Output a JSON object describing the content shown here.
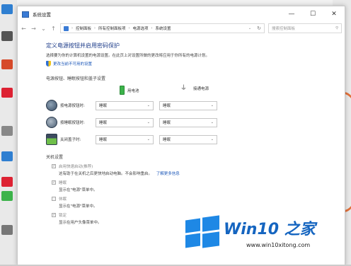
{
  "window": {
    "title": "系统设置",
    "minimize": "—",
    "maximize": "☐",
    "close": "✕"
  },
  "nav": {
    "back": "←",
    "forward": "→",
    "dropdown": "⌄",
    "up": "↑",
    "breadcrumb": [
      "控制面板",
      "所有控制面板项",
      "电源选项",
      "系统设置"
    ],
    "refresh": "↻",
    "search_placeholder": "搜索控制面板"
  },
  "main": {
    "heading": "定义电源按钮并启用密码保护",
    "description": "选择要为你的计算机设置的电源设置。在此页上对设置所做的更改将应用于你所有的电源计划。",
    "change_link": "更改当前不可用的设置",
    "buttons_section_title": "电源按钮、睡眠按钮和盖子设置",
    "col_battery": "用电池",
    "col_plugged": "接通电源",
    "rows": [
      {
        "label": "按电源按钮时:",
        "battery": "睡眠",
        "plugged": "睡眠"
      },
      {
        "label": "按睡眠按钮时:",
        "battery": "睡眠",
        "plugged": "睡眠"
      },
      {
        "label": "关闭盖子时:",
        "battery": "睡眠",
        "plugged": "睡眠"
      }
    ],
    "shutdown_title": "关机设置",
    "options": [
      {
        "label": "启用快速启动(推荐)",
        "desc": "这有助于在关机之后更快地启动电脑。不会影响重启。",
        "link": "了解更多信息",
        "checked": true
      },
      {
        "label": "睡眠",
        "desc": "显示在\"电源\"菜单中。",
        "checked": true
      },
      {
        "label": "休眠",
        "desc": "显示在\"电源\"菜单中。",
        "checked": false
      },
      {
        "label": "锁定",
        "desc": "显示在用户头像菜单中。",
        "checked": true
      }
    ]
  },
  "watermark": {
    "title": "Win10 之家",
    "url": "www.win10xitong.com"
  },
  "colors": {
    "heading": "#1e3d8a",
    "link": "#1a56b8",
    "logo_blue": "#1e88e5"
  }
}
